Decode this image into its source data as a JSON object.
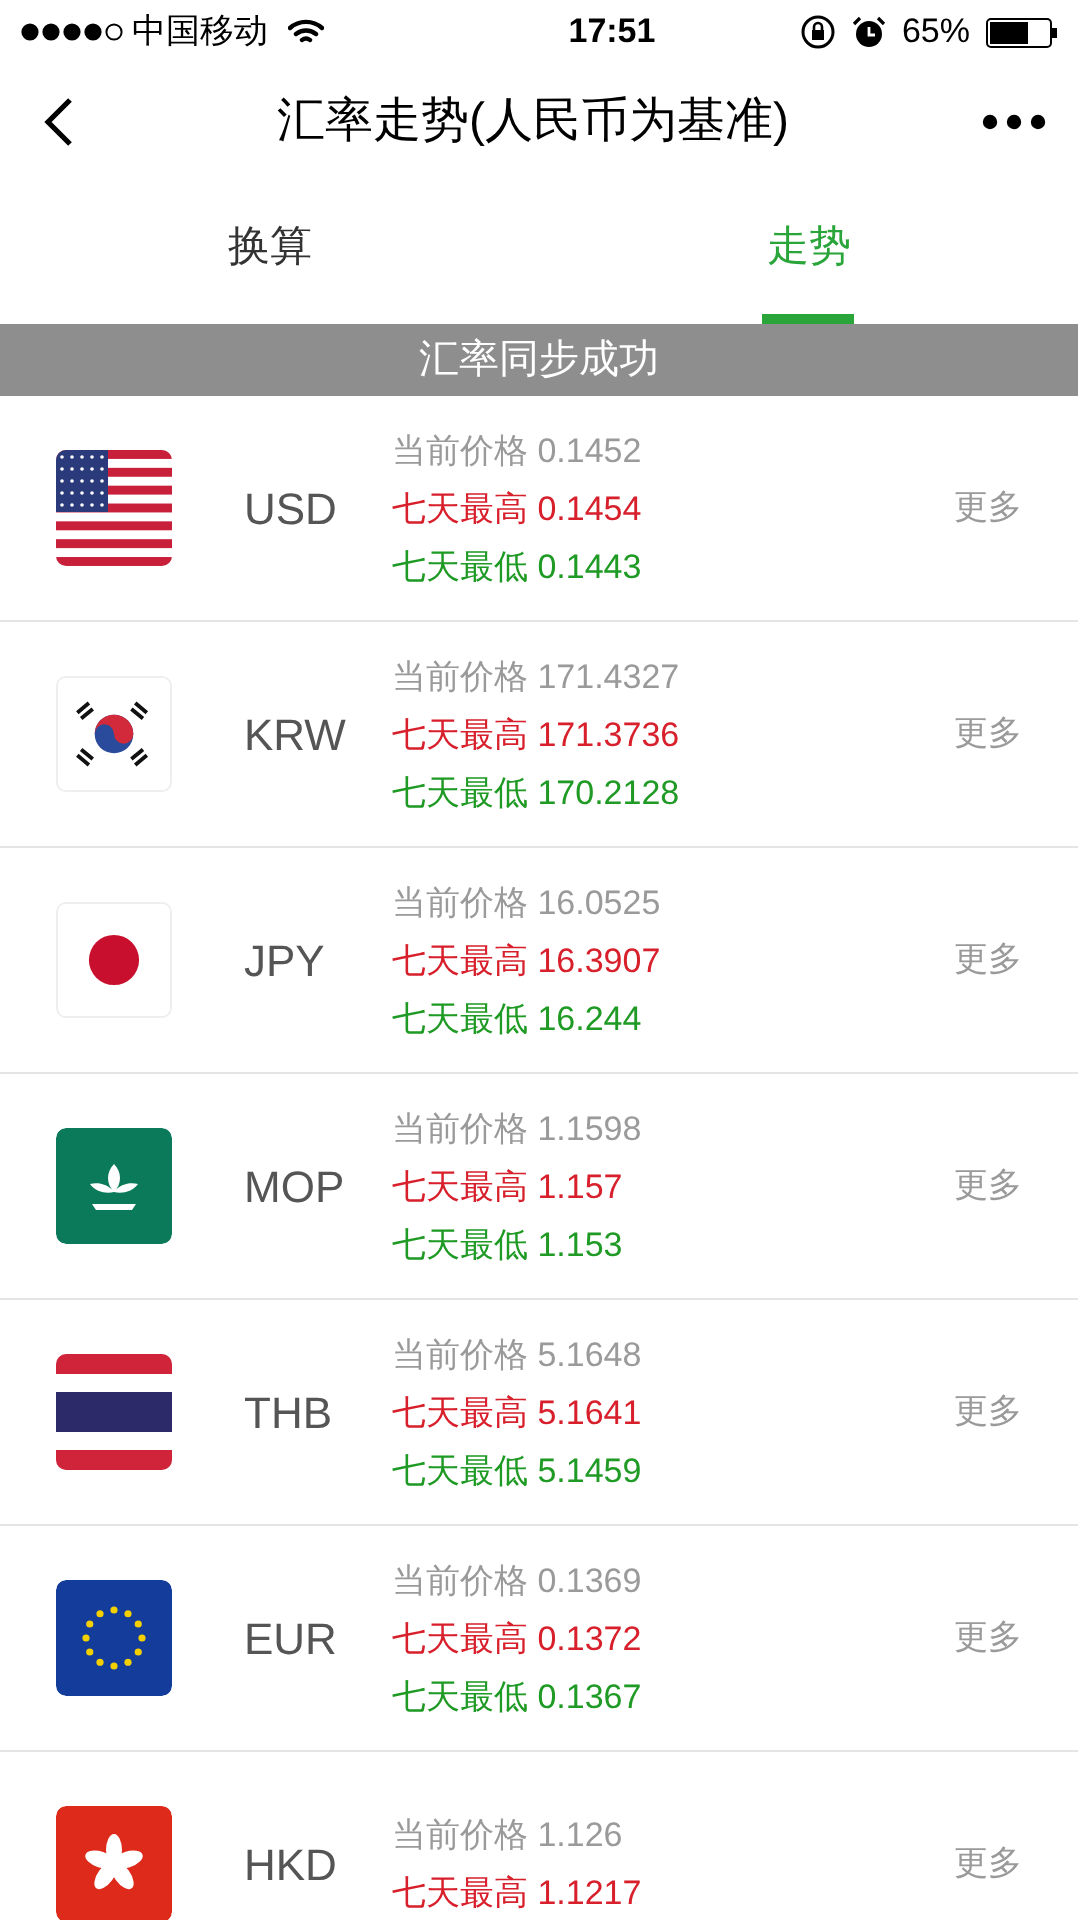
{
  "status_bar": {
    "carrier": "中国移动",
    "time": "17:51",
    "battery": "65%"
  },
  "nav": {
    "title": "汇率走势(人民币为基准)"
  },
  "tabs": [
    {
      "label": "换算",
      "selected": false
    },
    {
      "label": "走势",
      "selected": true
    }
  ],
  "banner": "汇率同步成功",
  "rates": [
    {
      "code": "USD",
      "current": "当前价格 0.1452",
      "high": "七天最高 0.1454",
      "low": "七天最低 0.1443",
      "more": "更多"
    },
    {
      "code": "KRW",
      "current": "当前价格 171.4327",
      "high": "七天最高 171.3736",
      "low": "七天最低 170.2128",
      "more": "更多"
    },
    {
      "code": "JPY",
      "current": "当前价格 16.0525",
      "high": "七天最高 16.3907",
      "low": "七天最低 16.244",
      "more": "更多"
    },
    {
      "code": "MOP",
      "current": "当前价格 1.1598",
      "high": "七天最高 1.157",
      "low": "七天最低 1.153",
      "more": "更多"
    },
    {
      "code": "THB",
      "current": "当前价格 5.1648",
      "high": "七天最高 5.1641",
      "low": "七天最低 5.1459",
      "more": "更多"
    },
    {
      "code": "EUR",
      "current": "当前价格 0.1369",
      "high": "七天最高 0.1372",
      "low": "七天最低 0.1367",
      "more": "更多"
    },
    {
      "code": "HKD",
      "current": "当前价格 1.126",
      "high": "七天最高 1.1217",
      "more": "更多"
    }
  ]
}
